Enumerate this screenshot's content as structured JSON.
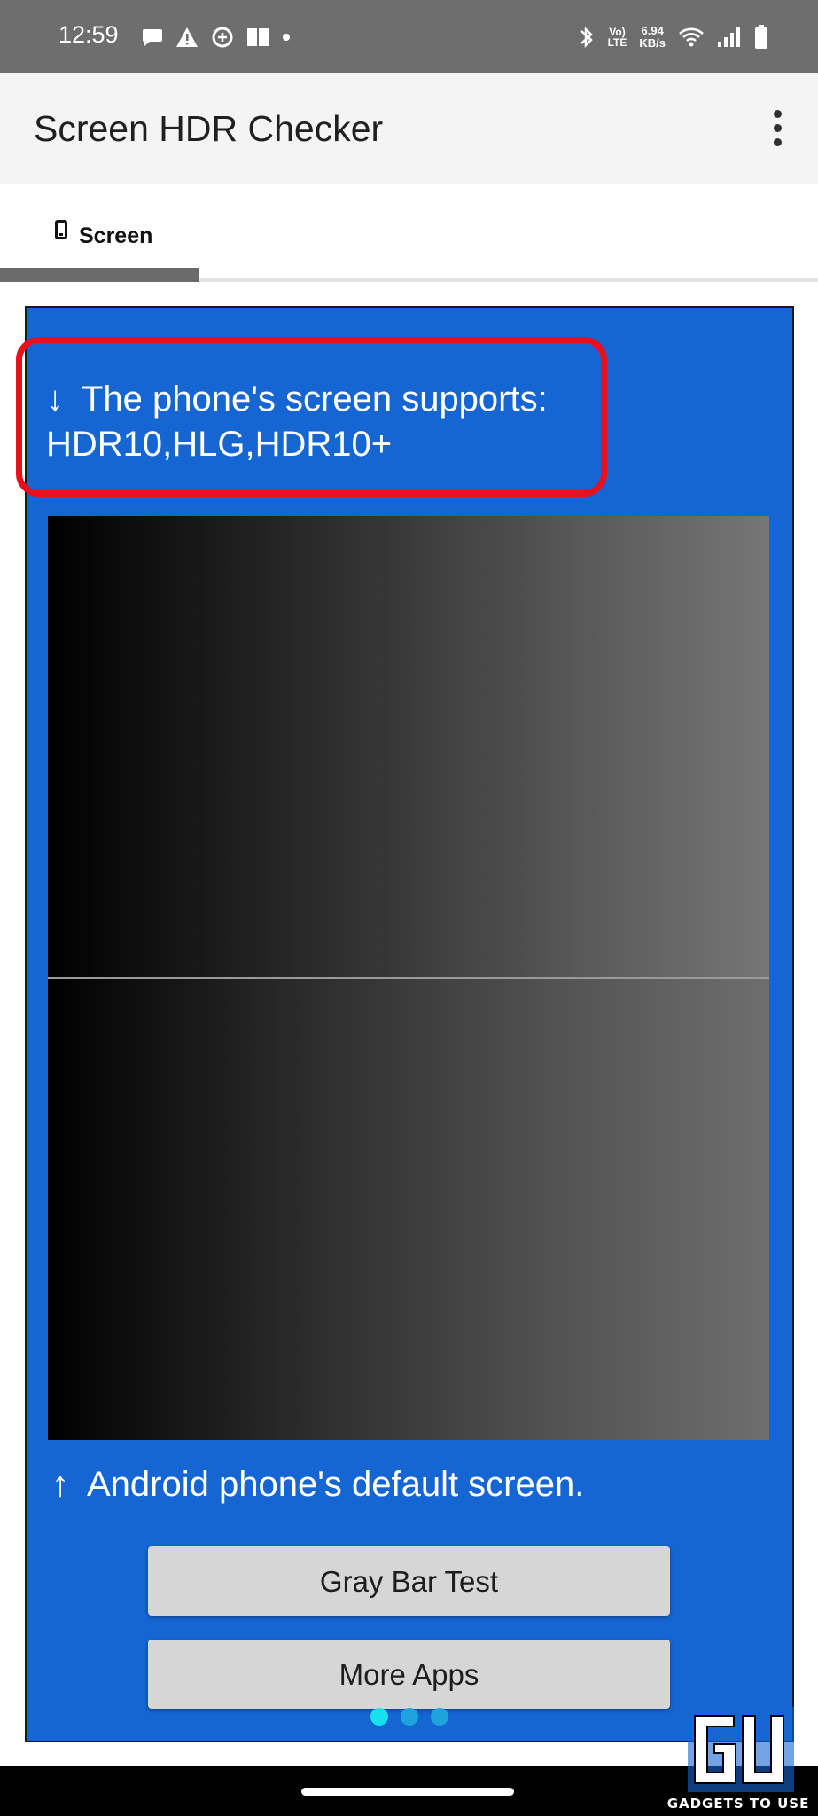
{
  "status_bar": {
    "time": "12:59",
    "left_icons": [
      "chat-bubble-icon",
      "warning-icon",
      "sync-icon",
      "book-icon",
      "dot-icon"
    ],
    "volte": "Vo)",
    "lte": "LTE",
    "net_speed_value": "6.94",
    "net_speed_unit": "KB/s"
  },
  "app_bar": {
    "title": "Screen HDR Checker"
  },
  "tabs": [
    {
      "label": "Screen",
      "icon": "phone-icon",
      "selected": true
    }
  ],
  "panel": {
    "support_label": "The phone's screen supports:",
    "support_value": "HDR10,HLG,HDR10+",
    "default_label": "Android phone's default screen.",
    "down_arrow": "↓",
    "up_arrow": "↑"
  },
  "buttons": {
    "gray_bar_test": "Gray Bar Test",
    "more_apps": "More Apps"
  },
  "pager": {
    "count": 3,
    "active_index": 0
  },
  "watermark": {
    "text": "GADGETS TO USE"
  },
  "colors": {
    "panel_blue": "#1565d2",
    "highlight_red": "#e8101c",
    "button_gray": "#d6d6d6",
    "dot_active": "#19e0ee",
    "dot_inactive": "#1ea3dc"
  }
}
